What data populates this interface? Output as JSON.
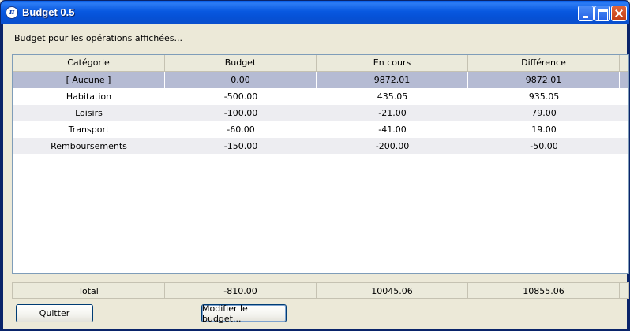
{
  "window": {
    "title": "Budget 0.5",
    "icon_label": "π"
  },
  "caption": "Budget pour les opérations affichées...",
  "table": {
    "columns": [
      "Catégorie",
      "Budget",
      "En cours",
      "Différence"
    ],
    "rows": [
      {
        "category": "[ Aucune ]",
        "budget": "0.00",
        "current": "9872.01",
        "difference": "9872.01",
        "selected": true
      },
      {
        "category": "Habitation",
        "budget": "-500.00",
        "current": "435.05",
        "difference": "935.05",
        "selected": false
      },
      {
        "category": "Loisirs",
        "budget": "-100.00",
        "current": "-21.00",
        "difference": "79.00",
        "selected": false
      },
      {
        "category": "Transport",
        "budget": "-60.00",
        "current": "-41.00",
        "difference": "19.00",
        "selected": false
      },
      {
        "category": "Remboursements",
        "budget": "-150.00",
        "current": "-200.00",
        "difference": "-50.00",
        "selected": false
      }
    ]
  },
  "totals": {
    "label": "Total",
    "budget": "-810.00",
    "current": "10045.06",
    "difference": "10855.06"
  },
  "buttons": {
    "quit": "Quitter",
    "edit_budget": "Modifier le budget..."
  },
  "colors": {
    "title_bar": "#0858E0",
    "selection": "#B5BBD3",
    "alt_row": "#EDEDF1"
  }
}
